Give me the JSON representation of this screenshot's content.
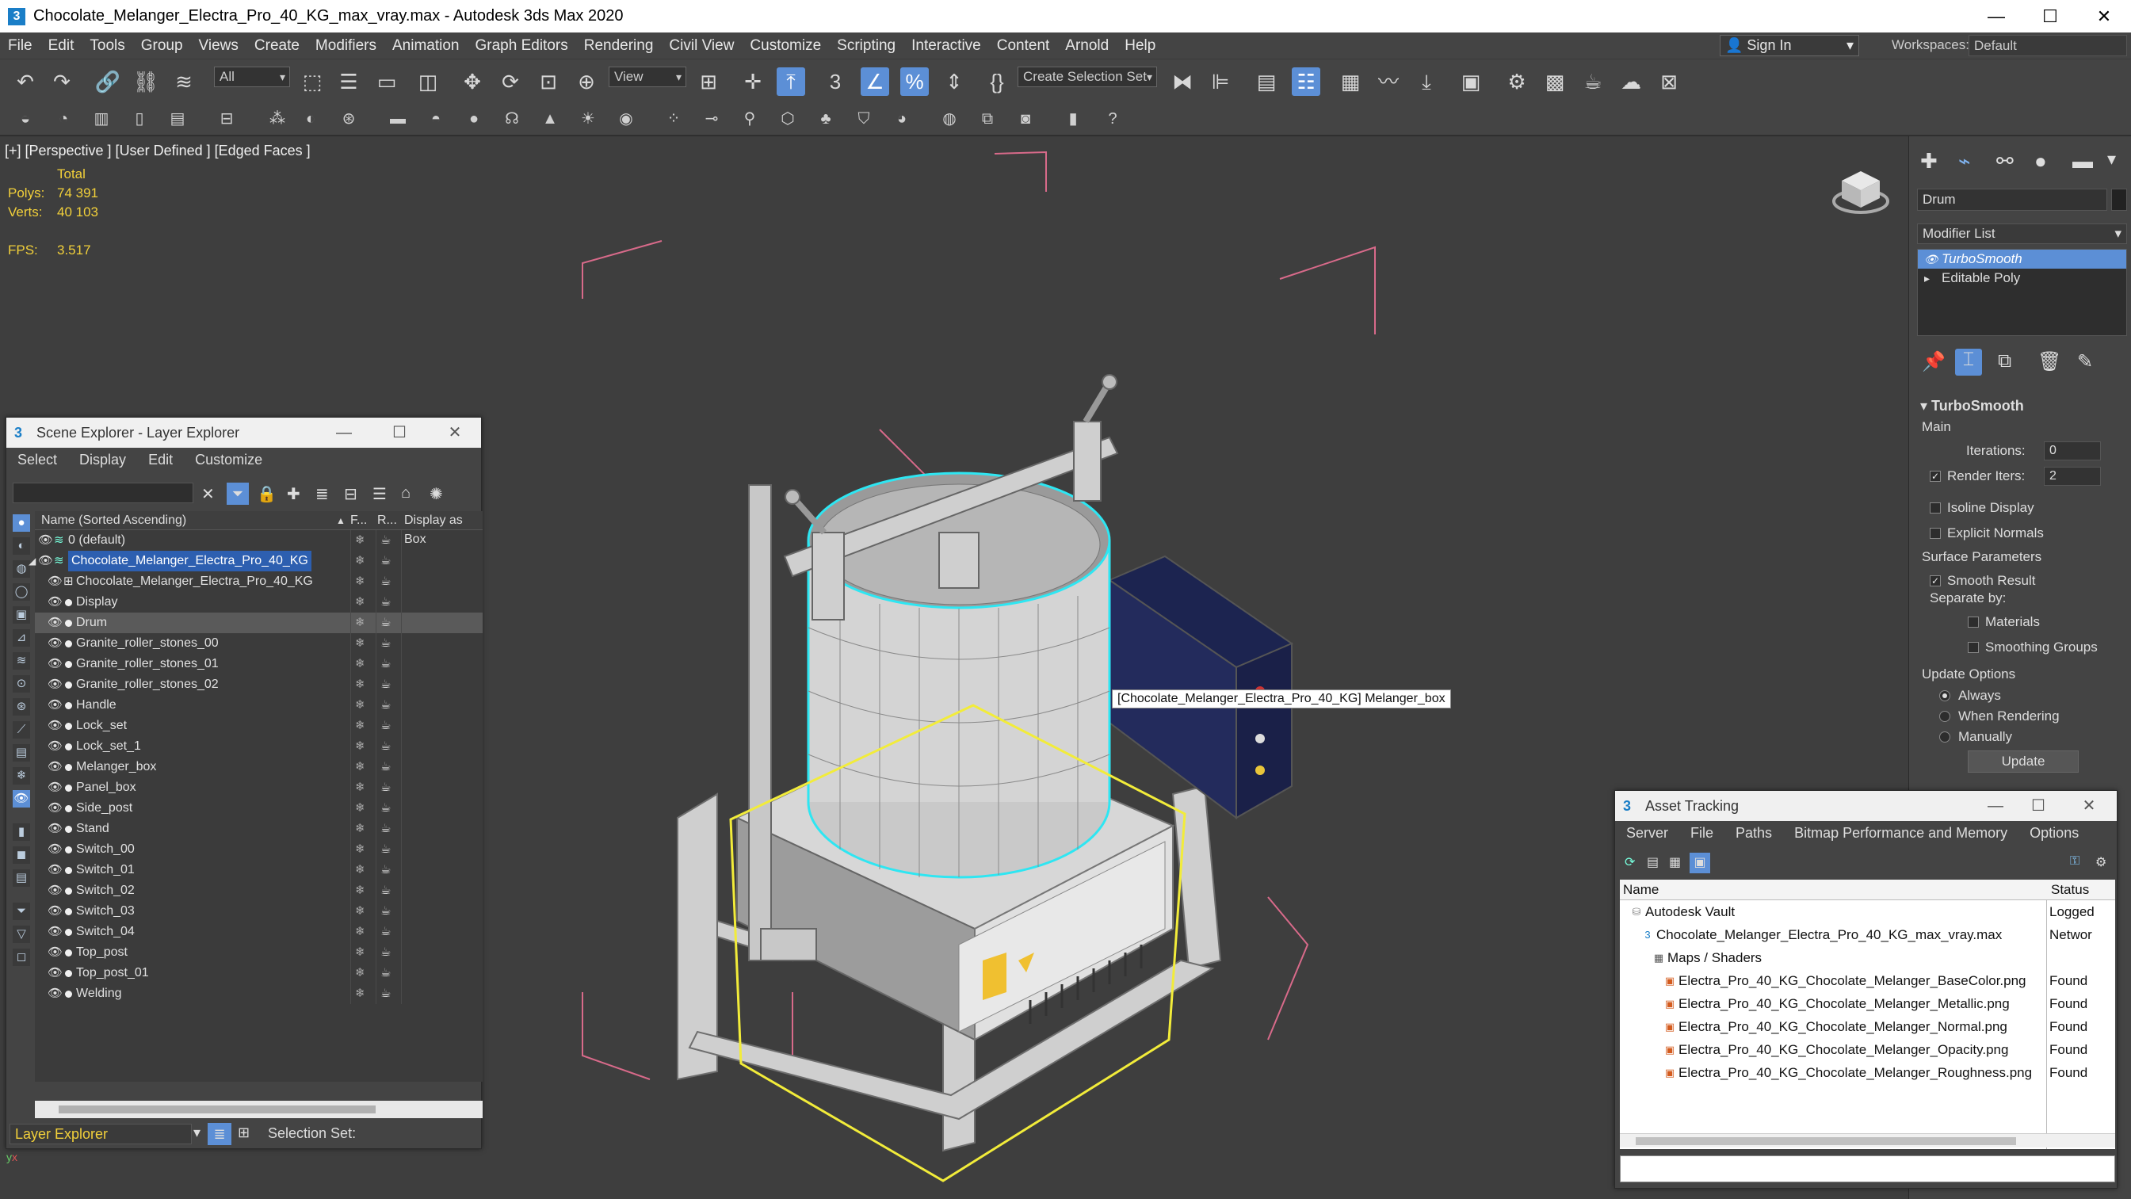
{
  "app": {
    "title": "Chocolate_Melanger_Electra_Pro_40_KG_max_vray.max - Autodesk 3ds Max 2020",
    "menu": [
      "File",
      "Edit",
      "Tools",
      "Group",
      "Views",
      "Create",
      "Modifiers",
      "Animation",
      "Graph Editors",
      "Rendering",
      "Civil View",
      "Customize",
      "Scripting",
      "Interactive",
      "Content",
      "Arnold",
      "Help"
    ],
    "sign_in": "Sign In",
    "workspaces_label": "Workspaces:",
    "workspace": "Default"
  },
  "toolbar": {
    "filter": "All",
    "view": "View",
    "selection_set": "Create Selection Set"
  },
  "viewport": {
    "label": "[+] [Perspective ] [User Defined ] [Edged Faces ]",
    "stats_total": "Total",
    "polys_label": "Polys:",
    "polys_value": "74 391",
    "verts_label": "Verts:",
    "verts_value": "40 103",
    "fps_label": "FPS:",
    "fps_value": "3.517",
    "tooltip": "[Chocolate_Melanger_Electra_Pro_40_KG] Melanger_box",
    "wire_color": "#2ee6f2",
    "sel_color": "#f2ec3a"
  },
  "command_panel": {
    "object_name": "Drum",
    "modifier_list": "Modifier List",
    "stack": [
      "TurboSmooth",
      "Editable Poly"
    ],
    "rollout_title": "TurboSmooth",
    "main": "Main",
    "iterations_label": "Iterations:",
    "iterations": "0",
    "render_iters_label": "Render Iters:",
    "render_iters": "2",
    "isoline": "Isoline Display",
    "explicit_normals": "Explicit Normals",
    "surface_params": "Surface Parameters",
    "smooth_result": "Smooth Result",
    "separate_by": "Separate by:",
    "materials": "Materials",
    "smoothing_groups": "Smoothing Groups",
    "update_options": "Update Options",
    "always": "Always",
    "when_rendering": "When Rendering",
    "manually": "Manually",
    "update_btn": "Update"
  },
  "scene_explorer": {
    "title": "Scene Explorer - Layer Explorer",
    "menu": [
      "Select",
      "Display",
      "Edit",
      "Customize"
    ],
    "col_name": "Name (Sorted Ascending)",
    "col_f": "F...",
    "col_r": "R...",
    "col_box": "Display as Box",
    "rows": [
      {
        "name": "0 (default)",
        "level": 0,
        "kind": "layer"
      },
      {
        "name": "Chocolate_Melanger_Electra_Pro_40_KG",
        "level": 0,
        "kind": "layer-sel"
      },
      {
        "name": "Chocolate_Melanger_Electra_Pro_40_KG",
        "level": 1,
        "kind": "group"
      },
      {
        "name": "Display",
        "level": 1,
        "kind": "obj"
      },
      {
        "name": "Drum",
        "level": 1,
        "kind": "obj-hl"
      },
      {
        "name": "Granite_roller_stones_00",
        "level": 1,
        "kind": "obj"
      },
      {
        "name": "Granite_roller_stones_01",
        "level": 1,
        "kind": "obj"
      },
      {
        "name": "Granite_roller_stones_02",
        "level": 1,
        "kind": "obj"
      },
      {
        "name": "Handle",
        "level": 1,
        "kind": "obj"
      },
      {
        "name": "Lock_set",
        "level": 1,
        "kind": "obj"
      },
      {
        "name": "Lock_set_1",
        "level": 1,
        "kind": "obj"
      },
      {
        "name": "Melanger_box",
        "level": 1,
        "kind": "obj"
      },
      {
        "name": "Panel_box",
        "level": 1,
        "kind": "obj"
      },
      {
        "name": "Side_post",
        "level": 1,
        "kind": "obj"
      },
      {
        "name": "Stand",
        "level": 1,
        "kind": "obj"
      },
      {
        "name": "Switch_00",
        "level": 1,
        "kind": "obj"
      },
      {
        "name": "Switch_01",
        "level": 1,
        "kind": "obj"
      },
      {
        "name": "Switch_02",
        "level": 1,
        "kind": "obj"
      },
      {
        "name": "Switch_03",
        "level": 1,
        "kind": "obj"
      },
      {
        "name": "Switch_04",
        "level": 1,
        "kind": "obj"
      },
      {
        "name": "Top_post",
        "level": 1,
        "kind": "obj"
      },
      {
        "name": "Top_post_01",
        "level": 1,
        "kind": "obj"
      },
      {
        "name": "Welding",
        "level": 1,
        "kind": "obj"
      }
    ],
    "footer_explorer": "Layer Explorer",
    "footer_selset": "Selection Set:"
  },
  "asset_tracking": {
    "title": "Asset Tracking",
    "menu": [
      "Server",
      "File",
      "Paths",
      "Bitmap Performance and Memory",
      "Options"
    ],
    "col_name": "Name",
    "col_status": "Status",
    "rows": [
      {
        "name": "Autodesk Vault",
        "status": "Logged",
        "level": 0,
        "icon": "vault"
      },
      {
        "name": "Chocolate_Melanger_Electra_Pro_40_KG_max_vray.max",
        "status": "Networ",
        "level": 1,
        "icon": "max"
      },
      {
        "name": "Maps / Shaders",
        "status": "",
        "level": 2,
        "icon": "folder"
      },
      {
        "name": "Electra_Pro_40_KG_Chocolate_Melanger_BaseColor.png",
        "status": "Found",
        "level": 3,
        "icon": "img"
      },
      {
        "name": "Electra_Pro_40_KG_Chocolate_Melanger_Metallic.png",
        "status": "Found",
        "level": 3,
        "icon": "img"
      },
      {
        "name": "Electra_Pro_40_KG_Chocolate_Melanger_Normal.png",
        "status": "Found",
        "level": 3,
        "icon": "img"
      },
      {
        "name": "Electra_Pro_40_KG_Chocolate_Melanger_Opacity.png",
        "status": "Found",
        "level": 3,
        "icon": "img"
      },
      {
        "name": "Electra_Pro_40_KG_Chocolate_Melanger_Roughness.png",
        "status": "Found",
        "level": 3,
        "icon": "img"
      }
    ]
  }
}
